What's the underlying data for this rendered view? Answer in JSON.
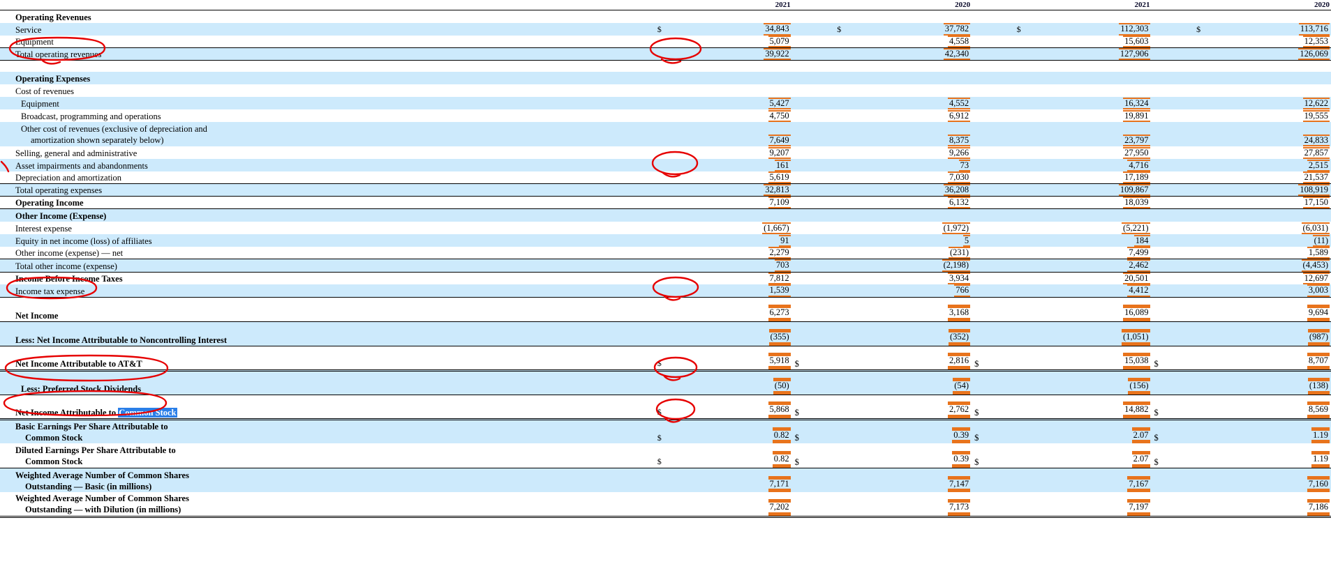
{
  "document": {
    "kind": "consolidated-statement-of-income",
    "columns": [
      "2021",
      "2020",
      "2021",
      "2020"
    ],
    "currency_symbol": "$"
  },
  "colors": {
    "row_shade": "#cdeafc",
    "highlight_rule": "#e8731c",
    "selection_bg": "#2a7fe8",
    "selection_fg": "#ffffff",
    "annotation_ink": "#e60000"
  },
  "selection": {
    "text": "Common Stock",
    "prefix": "Net Income Attributable to "
  },
  "sections": [
    {
      "id": "operating-revenues",
      "heading": "Operating Revenues",
      "rows": [
        {
          "label": "Service",
          "indent": 1,
          "cur": [
            "$",
            "$",
            "$",
            "$"
          ],
          "values": [
            "34,843",
            "37,782",
            "112,303",
            "113,716"
          ]
        },
        {
          "label": "Equipment",
          "indent": 1,
          "cur": [
            "",
            "",
            "",
            ""
          ],
          "values": [
            "5,079",
            "4,558",
            "15,603",
            "12,353"
          ]
        },
        {
          "label": "Total operating revenues",
          "indent": 1,
          "cur": [
            "",
            "",
            "",
            ""
          ],
          "values": [
            "39,922",
            "42,340",
            "127,906",
            "126,069"
          ]
        }
      ]
    },
    {
      "id": "operating-expenses",
      "heading": "Operating Expenses",
      "rows": [
        {
          "label": "Cost of revenues",
          "indent": 1,
          "cur": [
            "",
            "",
            "",
            ""
          ],
          "values": [
            "",
            "",
            "",
            ""
          ]
        },
        {
          "label": "Equipment",
          "indent": 2,
          "cur": [
            "",
            "",
            "",
            ""
          ],
          "values": [
            "5,427",
            "4,552",
            "16,324",
            "12,622"
          ]
        },
        {
          "label": "Broadcast, programming and operations",
          "indent": 2,
          "cur": [
            "",
            "",
            "",
            ""
          ],
          "values": [
            "4,750",
            "6,912",
            "19,891",
            "19,555"
          ]
        },
        {
          "label": "Other cost of revenues (exclusive of depreciation and",
          "label2": "amortization shown separately below)",
          "indent": 2,
          "cur": [
            "",
            "",
            "",
            ""
          ],
          "values": [
            "7,649",
            "8,375",
            "23,797",
            "24,833"
          ]
        },
        {
          "label": "Selling, general and administrative",
          "indent": 1,
          "cur": [
            "",
            "",
            "",
            ""
          ],
          "values": [
            "9,207",
            "9,266",
            "27,950",
            "27,857"
          ]
        },
        {
          "label": "Asset impairments and abandonments",
          "indent": 1,
          "cur": [
            "",
            "",
            "",
            ""
          ],
          "values": [
            "161",
            "73",
            "4,716",
            "2,515"
          ]
        },
        {
          "label": "Depreciation and amortization",
          "indent": 1,
          "cur": [
            "",
            "",
            "",
            ""
          ],
          "values": [
            "5,619",
            "7,030",
            "17,189",
            "21,537"
          ]
        },
        {
          "label": "Total operating expenses",
          "indent": 1,
          "cur": [
            "",
            "",
            "",
            ""
          ],
          "values": [
            "32,813",
            "36,208",
            "109,867",
            "108,919"
          ]
        }
      ]
    },
    {
      "id": "operating-income",
      "rows": [
        {
          "label": "Operating Income",
          "bold": true,
          "indent": 1,
          "cur": [
            "",
            "",
            "",
            ""
          ],
          "values": [
            "7,109",
            "6,132",
            "18,039",
            "17,150"
          ]
        }
      ]
    },
    {
      "id": "other-income-expense",
      "heading": "Other Income (Expense)",
      "rows": [
        {
          "label": "Interest expense",
          "indent": 1,
          "cur": [
            "",
            "",
            "",
            ""
          ],
          "values": [
            "(1,667)",
            "(1,972)",
            "(5,221)",
            "(6,031)"
          ]
        },
        {
          "label": "Equity in net income (loss) of affiliates",
          "indent": 1,
          "cur": [
            "",
            "",
            "",
            ""
          ],
          "values": [
            "91",
            "5",
            "184",
            "(11)"
          ]
        },
        {
          "label": "Other income (expense) — net",
          "indent": 1,
          "cur": [
            "",
            "",
            "",
            ""
          ],
          "values": [
            "2,279",
            "(231)",
            "7,499",
            "1,589"
          ]
        },
        {
          "label": "Total other income (expense)",
          "indent": 1,
          "cur": [
            "",
            "",
            "",
            ""
          ],
          "values": [
            "703",
            "(2,198)",
            "2,462",
            "(4,453)"
          ]
        }
      ]
    },
    {
      "id": "income-before-taxes",
      "rows": [
        {
          "label": "Income Before Income Taxes",
          "bold": true,
          "indent": 1,
          "cur": [
            "",
            "",
            "",
            ""
          ],
          "values": [
            "7,812",
            "3,934",
            "20,501",
            "12,697"
          ]
        },
        {
          "label": "Income tax expense",
          "indent": 1,
          "cur": [
            "",
            "",
            "",
            ""
          ],
          "values": [
            "1,539",
            "766",
            "4,412",
            "3,003"
          ]
        },
        {
          "label": "Net Income",
          "bold": true,
          "indent": 1,
          "cur": [
            "",
            "",
            "",
            ""
          ],
          "values": [
            "6,273",
            "3,168",
            "16,089",
            "9,694"
          ]
        },
        {
          "label": "Less: Net Income Attributable to Noncontrolling Interest",
          "bold": true,
          "indent": 1,
          "cur": [
            "",
            "",
            "",
            ""
          ],
          "values": [
            "(355)",
            "(352)",
            "(1,051)",
            "(987)"
          ]
        },
        {
          "label": "Net Income Attributable to AT&T",
          "bold": true,
          "indent": 1,
          "cur": [
            "$",
            "$",
            "$",
            "$"
          ],
          "values": [
            "5,918",
            "2,816",
            "15,038",
            "8,707"
          ]
        },
        {
          "label": "Less: Preferred Stock Dividends",
          "bold": true,
          "indent": 2,
          "cur": [
            "",
            "",
            "",
            ""
          ],
          "values": [
            "(50)",
            "(54)",
            "(156)",
            "(138)"
          ]
        },
        {
          "label": "Net Income Attributable to Common Stock",
          "bold": true,
          "indent": 1,
          "cur": [
            "$",
            "$",
            "$",
            "$"
          ],
          "values": [
            "5,868",
            "2,762",
            "14,882",
            "8,569"
          ]
        }
      ]
    },
    {
      "id": "eps",
      "rows": [
        {
          "label": "Basic Earnings Per Share Attributable to",
          "label2": "Common Stock",
          "bold": true,
          "indent": 1,
          "cur": [
            "$",
            "$",
            "$",
            "$"
          ],
          "values": [
            "0.82",
            "0.39",
            "2.07",
            "1.19"
          ]
        },
        {
          "label": "Diluted Earnings Per Share Attributable to",
          "label2": "Common Stock",
          "bold": true,
          "indent": 1,
          "cur": [
            "$",
            "$",
            "$",
            "$"
          ],
          "values": [
            "0.82",
            "0.39",
            "2.07",
            "1.19"
          ]
        },
        {
          "label": "Weighted Average Number of Common Shares",
          "label2": "Outstanding — Basic (in millions)",
          "bold": true,
          "indent": 1,
          "cur": [
            "",
            "",
            "",
            ""
          ],
          "values": [
            "7,171",
            "7,147",
            "7,167",
            "7,160"
          ]
        },
        {
          "label": "Weighted Average Number of Common Shares",
          "label2": "Outstanding — with Dilution (in millions)",
          "bold": true,
          "indent": 1,
          "cur": [
            "",
            "",
            "",
            ""
          ],
          "values": [
            "7,202",
            "7,173",
            "7,197",
            "7,186"
          ]
        }
      ]
    }
  ],
  "annotations": [
    {
      "name": "circle-total-operating-revenues-label"
    },
    {
      "name": "circle-total-operating-revenues-value"
    },
    {
      "name": "tick-asset-impairments"
    },
    {
      "name": "circle-asset-impairments-value"
    },
    {
      "name": "circle-income-tax-expense-label"
    },
    {
      "name": "circle-income-tax-expense-value"
    },
    {
      "name": "circle-net-income-common-stock-label"
    },
    {
      "name": "circle-net-income-common-stock-value"
    },
    {
      "name": "circle-diluted-eps-label"
    },
    {
      "name": "circle-diluted-eps-value"
    }
  ]
}
